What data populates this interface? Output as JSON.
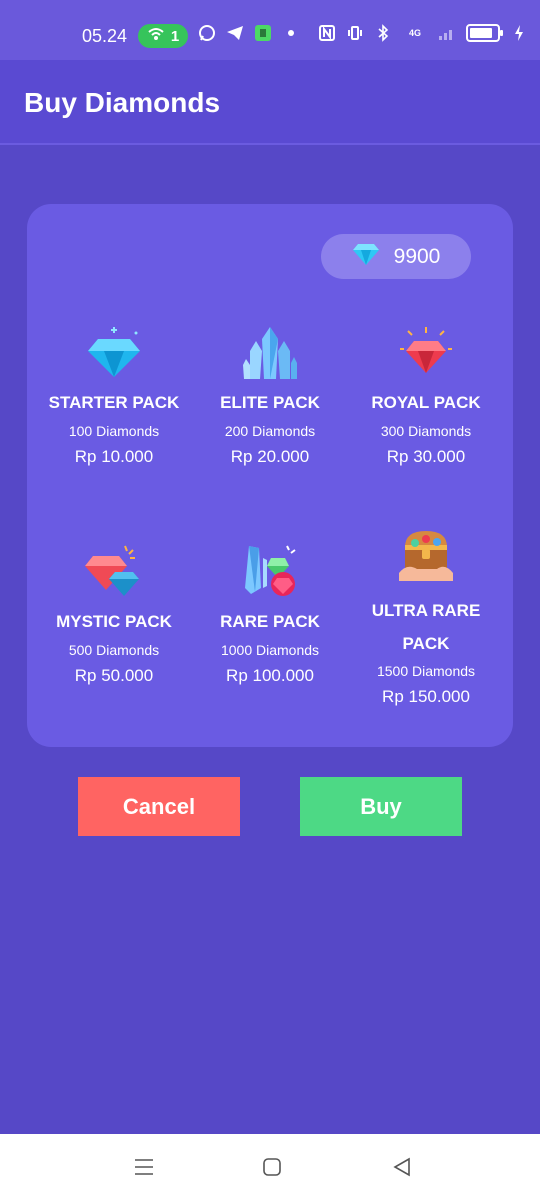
{
  "status_bar": {
    "time": "05.24",
    "hotspot_count": "1",
    "network_label": "4G"
  },
  "header": {
    "title": "Buy Diamonds"
  },
  "balance": {
    "value": "9900",
    "icon": "diamond-icon"
  },
  "packs": [
    {
      "name": "STARTER PACK",
      "amount": "100 Diamonds",
      "price": "Rp 10.000",
      "icon": "blue-diamond-icon"
    },
    {
      "name": "ELITE PACK",
      "amount": "200 Diamonds",
      "price": "Rp 20.000",
      "icon": "crystal-cluster-icon"
    },
    {
      "name": "ROYAL PACK",
      "amount": "300 Diamonds",
      "price": "Rp 30.000",
      "icon": "red-diamond-icon"
    },
    {
      "name": "MYSTIC PACK",
      "amount": "500 Diamonds",
      "price": "Rp 50.000",
      "icon": "twin-gems-icon"
    },
    {
      "name": "RARE PACK",
      "amount": "1000 Diamonds",
      "price": "Rp 100.000",
      "icon": "crystal-gems-icon"
    },
    {
      "name": "ULTRA RARE PACK",
      "amount": "1500 Diamonds",
      "price": "Rp 150.000",
      "icon": "treasure-chest-icon"
    }
  ],
  "actions": {
    "cancel_label": "Cancel",
    "buy_label": "Buy"
  },
  "colors": {
    "background": "#5648c7",
    "card": "#6a5be3",
    "cancel": "#ff6462",
    "buy": "#4dd985"
  }
}
